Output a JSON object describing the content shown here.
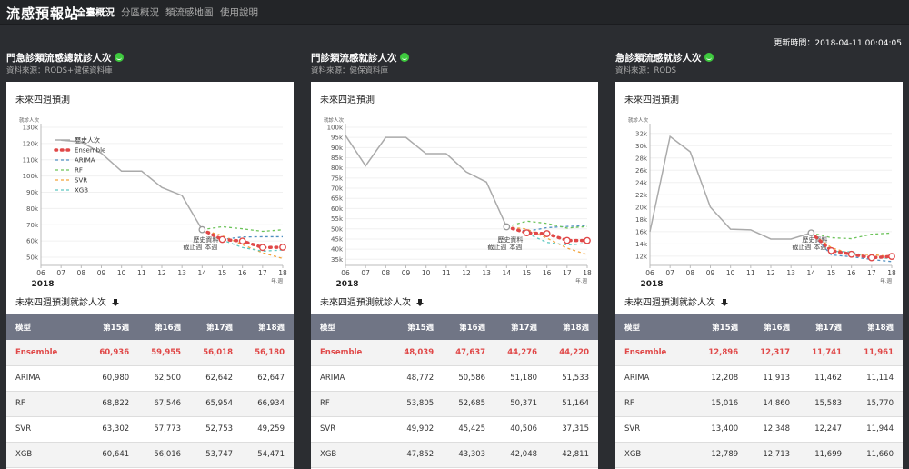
{
  "navbar": {
    "brand": "流感預報站",
    "links": [
      "全臺概況",
      "分區概況",
      "類流感地圖",
      "使用說明"
    ]
  },
  "update_time": "更新時間：2018-04-11 00:04:05",
  "colors": {
    "history": "#aaaaaa",
    "ensemble": "#e04848",
    "arima": "#4f8fc0",
    "rf": "#6cc35a",
    "svr": "#f2a33a",
    "xgb": "#5ec8c0"
  },
  "panels": [
    {
      "title": "門急診類流感總就診人次",
      "source": "資料來源：RODS+健保資料庫",
      "chart_title": "未來四週預測",
      "table_title": "未來四週預測就診人次",
      "table": {
        "headers": [
          "模型",
          "第15週",
          "第16週",
          "第17週",
          "第18週"
        ],
        "rows": [
          [
            "Ensemble",
            "60,936",
            "59,955",
            "56,018",
            "56,180"
          ],
          [
            "ARIMA",
            "60,980",
            "62,500",
            "62,642",
            "62,647"
          ],
          [
            "RF",
            "68,822",
            "67,546",
            "65,954",
            "66,934"
          ],
          [
            "SVR",
            "63,302",
            "57,773",
            "52,753",
            "49,259"
          ],
          [
            "XGB",
            "60,641",
            "56,016",
            "53,747",
            "54,471"
          ]
        ]
      }
    },
    {
      "title": "門診類流感就診人次",
      "source": "資料來源：健保資料庫",
      "chart_title": "未來四週預測",
      "table_title": "未來四週預測就診人次",
      "table": {
        "headers": [
          "模型",
          "第15週",
          "第16週",
          "第17週",
          "第18週"
        ],
        "rows": [
          [
            "Ensemble",
            "48,039",
            "47,637",
            "44,276",
            "44,220"
          ],
          [
            "ARIMA",
            "48,772",
            "50,586",
            "51,180",
            "51,533"
          ],
          [
            "RF",
            "53,805",
            "52,685",
            "50,371",
            "51,164"
          ],
          [
            "SVR",
            "49,902",
            "45,425",
            "40,506",
            "37,315"
          ],
          [
            "XGB",
            "47,852",
            "43,303",
            "42,048",
            "42,811"
          ]
        ]
      }
    },
    {
      "title": "急診類流感就診人次",
      "source": "資料來源：RODS",
      "chart_title": "未來四週預測",
      "table_title": "未來四週預測就診人次",
      "table": {
        "headers": [
          "模型",
          "第15週",
          "第16週",
          "第17週",
          "第18週"
        ],
        "rows": [
          [
            "Ensemble",
            "12,896",
            "12,317",
            "11,741",
            "11,961"
          ],
          [
            "ARIMA",
            "12,208",
            "11,913",
            "11,462",
            "11,114"
          ],
          [
            "RF",
            "15,016",
            "14,860",
            "15,583",
            "15,770"
          ],
          [
            "SVR",
            "13,400",
            "12,348",
            "12,247",
            "11,944"
          ],
          [
            "XGB",
            "12,789",
            "12,713",
            "11,699",
            "11,660"
          ]
        ]
      }
    }
  ],
  "chart_data": [
    {
      "type": "line",
      "ylabel": "就診人次",
      "xlabel": "年.週",
      "year_label": "2018",
      "hist_annotation": [
        "歷史資料",
        "截止週",
        "本週"
      ],
      "x": [
        "06",
        "07",
        "08",
        "09",
        "10",
        "11",
        "12",
        "13",
        "14",
        "15",
        "16",
        "17",
        "18"
      ],
      "ylim": [
        45000,
        130000
      ],
      "yticks": [
        50000,
        60000,
        70000,
        80000,
        90000,
        100000,
        110000,
        120000,
        130000
      ],
      "ytick_labels": [
        "50k",
        "60k",
        "70k",
        "80k",
        "90k",
        "100k",
        "110k",
        "120k",
        "130k"
      ],
      "legend": [
        "歷史人次",
        "Ensemble",
        "ARIMA",
        "RF",
        "SVR",
        "XGB"
      ],
      "legend_position": "top-left",
      "history": [
        122000,
        121000,
        114000,
        103000,
        103000,
        93000,
        88000,
        67000
      ],
      "series": [
        {
          "name": "Ensemble",
          "values": [
            67000,
            60936,
            59955,
            56018,
            56180
          ]
        },
        {
          "name": "ARIMA",
          "values": [
            67000,
            60980,
            62500,
            62642,
            62647
          ]
        },
        {
          "name": "RF",
          "values": [
            67000,
            68822,
            67546,
            65954,
            66934
          ]
        },
        {
          "name": "SVR",
          "values": [
            67000,
            63302,
            57773,
            52753,
            49259
          ]
        },
        {
          "name": "XGB",
          "values": [
            67000,
            60641,
            56016,
            53747,
            54471
          ]
        }
      ]
    },
    {
      "type": "line",
      "ylabel": "就診人次",
      "xlabel": "年.週",
      "year_label": "2018",
      "hist_annotation": [
        "歷史資料",
        "截止週",
        "本週"
      ],
      "x": [
        "06",
        "07",
        "08",
        "09",
        "10",
        "11",
        "12",
        "13",
        "14",
        "15",
        "16",
        "17",
        "18"
      ],
      "ylim": [
        32000,
        100000
      ],
      "yticks": [
        35000,
        40000,
        45000,
        50000,
        55000,
        60000,
        65000,
        70000,
        75000,
        80000,
        85000,
        90000,
        95000,
        100000
      ],
      "ytick_labels": [
        "35k",
        "40k",
        "45k",
        "50k",
        "55k",
        "60k",
        "65k",
        "70k",
        "75k",
        "80k",
        "85k",
        "90k",
        "95k",
        "100k"
      ],
      "legend": [],
      "history": [
        96000,
        81000,
        95000,
        95000,
        87000,
        87000,
        78000,
        73000,
        51000
      ],
      "series": [
        {
          "name": "Ensemble",
          "values": [
            51000,
            48039,
            47637,
            44276,
            44220
          ]
        },
        {
          "name": "ARIMA",
          "values": [
            51000,
            48772,
            50586,
            51180,
            51533
          ]
        },
        {
          "name": "RF",
          "values": [
            51000,
            53805,
            52685,
            50371,
            51164
          ]
        },
        {
          "name": "SVR",
          "values": [
            51000,
            49902,
            45425,
            40506,
            37315
          ]
        },
        {
          "name": "XGB",
          "values": [
            51000,
            47852,
            43303,
            42048,
            42811
          ]
        }
      ]
    },
    {
      "type": "line",
      "ylabel": "就診人次",
      "xlabel": "年.週",
      "year_label": "2018",
      "hist_annotation": [
        "歷史資料",
        "截止週",
        "本週"
      ],
      "x": [
        "06",
        "07",
        "08",
        "09",
        "10",
        "11",
        "12",
        "13",
        "14",
        "15",
        "16",
        "17",
        "18"
      ],
      "ylim": [
        10500,
        33000
      ],
      "yticks": [
        12000,
        14000,
        16000,
        18000,
        20000,
        22000,
        24000,
        26000,
        28000,
        30000,
        32000
      ],
      "ytick_labels": [
        "12k",
        "14k",
        "16k",
        "18k",
        "20k",
        "22k",
        "24k",
        "26k",
        "28k",
        "30k",
        "32k"
      ],
      "legend": [],
      "history": [
        16000,
        31500,
        29000,
        20000,
        16400,
        16300,
        14800,
        14800,
        15800
      ],
      "series": [
        {
          "name": "Ensemble",
          "values": [
            15800,
            12896,
            12317,
            11741,
            11961
          ]
        },
        {
          "name": "ARIMA",
          "values": [
            15800,
            12208,
            11913,
            11462,
            11114
          ]
        },
        {
          "name": "RF",
          "values": [
            15800,
            15016,
            14860,
            15583,
            15770
          ]
        },
        {
          "name": "SVR",
          "values": [
            15800,
            13400,
            12348,
            12247,
            11944
          ]
        },
        {
          "name": "XGB",
          "values": [
            15800,
            12789,
            12713,
            11699,
            11660
          ]
        }
      ]
    }
  ]
}
